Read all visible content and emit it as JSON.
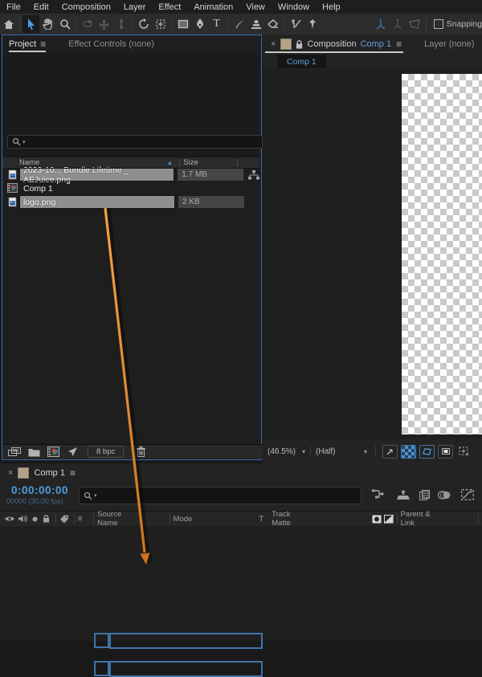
{
  "menu": {
    "items": [
      "File",
      "Edit",
      "Composition",
      "Layer",
      "Effect",
      "Animation",
      "View",
      "Window",
      "Help"
    ]
  },
  "toolbar": {
    "snapping_label": "Snapping"
  },
  "project_panel": {
    "tab_project": "Project",
    "tab_effect_controls": "Effect Controls (none)",
    "menu_glyph": "≡",
    "columns": {
      "name": "Name",
      "size": "Size"
    },
    "sort_glyph": "▲",
    "items": [
      {
        "name": "2023-10... Bundle Lifetime _ AEJuice.png",
        "size": "1.7 MB",
        "type": "png"
      },
      {
        "name": "Comp 1",
        "size": "",
        "type": "comp"
      },
      {
        "name": "logo.png",
        "size": "2 KB",
        "type": "png"
      }
    ],
    "footer": {
      "bpc_label": "8 bpc"
    }
  },
  "comp_panel": {
    "close_glyph": "×",
    "tab_title": "Composition",
    "tab_comp_name": "Comp 1",
    "menu_glyph": "≡",
    "layer_tab": "Layer (none)",
    "viewer_tab": "Comp 1",
    "zoom_value": "(46.5%)",
    "resolution_value": "(Half)",
    "chevron": "⌄"
  },
  "timeline": {
    "close_glyph": "×",
    "tab": "Comp 1",
    "menu_glyph": "≡",
    "timecode": "0:00:00:00",
    "frame_info": "00000 (30.00 fps)",
    "columns": {
      "number": "#",
      "source_name": "Source Name",
      "mode": "Mode",
      "t": "T",
      "track_matte": "Track Matte",
      "parent_link": "Parent & Link"
    }
  },
  "colors": {
    "accent_blue": "#4e9de0",
    "panel_border_blue": "#3c6fae",
    "selection_gray": "#8f8f8f",
    "swatch_tan": "#b3a287",
    "arrow_orange": "#ef8b2d",
    "checker_light": "#ffffff",
    "checker_dark": "#c9c9c9"
  }
}
